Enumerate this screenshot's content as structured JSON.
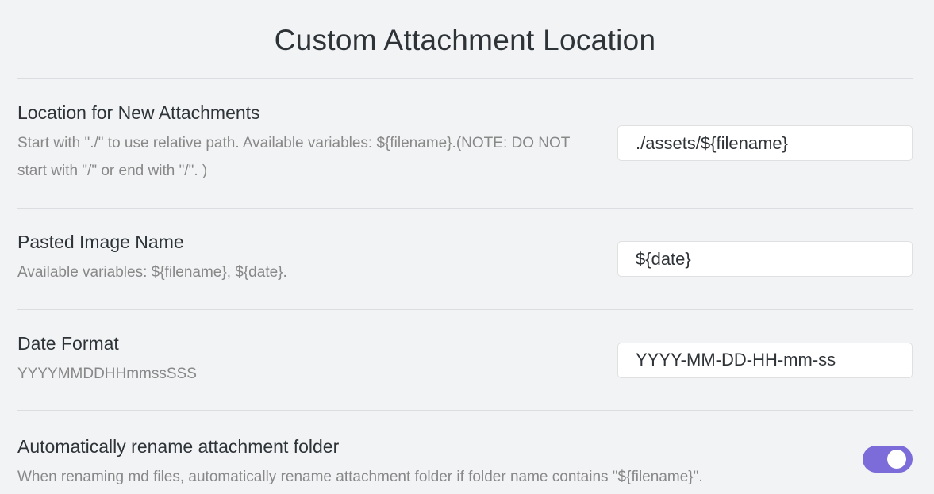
{
  "header": {
    "title": "Custom Attachment Location"
  },
  "settings": [
    {
      "name": "Location for New Attachments",
      "description": "Start with \"./\" to use relative path. Available variables: ${filename}.(NOTE: DO NOT start with \"/\" or end with \"/\". )",
      "value": "./assets/${filename}"
    },
    {
      "name": "Pasted Image Name",
      "description": "Available variables: ${filename}, ${date}.",
      "value": "${date}"
    },
    {
      "name": "Date Format",
      "description": "YYYYMMDDHHmmssSSS",
      "value": "YYYY-MM-DD-HH-mm-ss"
    },
    {
      "name": "Automatically rename attachment folder",
      "description": "When renaming md files, automatically rename attachment folder if folder name contains \"${filename}\".",
      "toggle_on": true
    }
  ],
  "colors": {
    "accent": "#7b6cd9",
    "background": "#f2f3f5",
    "muted_text": "#888888"
  }
}
